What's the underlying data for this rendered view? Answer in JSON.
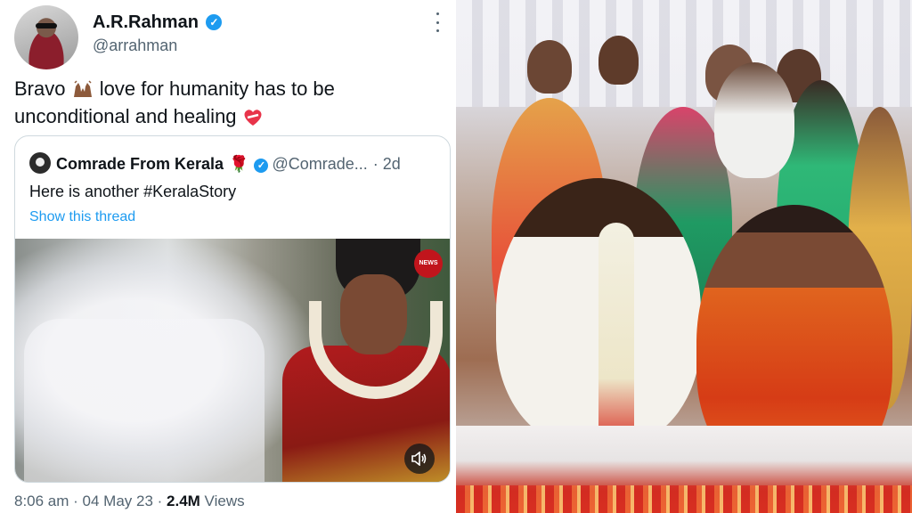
{
  "tweet": {
    "author_name": "A.R.Rahman",
    "author_handle": "@arrahman",
    "text_line1": "Bravo",
    "text_line1b": " love for humanity has to be",
    "text_line2": "unconditional and healing",
    "quote": {
      "name": "Comrade From Kerala",
      "handle": "@Comrade...",
      "dot_time": "· 2d",
      "text": "Here is another #KeralaStory",
      "show_thread": "Show this thread",
      "badge": "NEWS"
    },
    "timestamp": "8:06 am · 04 May 23 · ",
    "views_count": "2.4M",
    "views_label": " Views"
  },
  "icons": {
    "verified": "verified-badge-icon",
    "more": "more-options-icon",
    "rose": "rose-emoji-icon",
    "hands": "raising-hands-emoji-icon",
    "heart": "mending-heart-emoji-icon",
    "volume": "volume-icon"
  },
  "colors": {
    "accent": "#1d9bf0",
    "text": "#0f1419",
    "muted": "#536471",
    "border": "#cfd9de"
  }
}
